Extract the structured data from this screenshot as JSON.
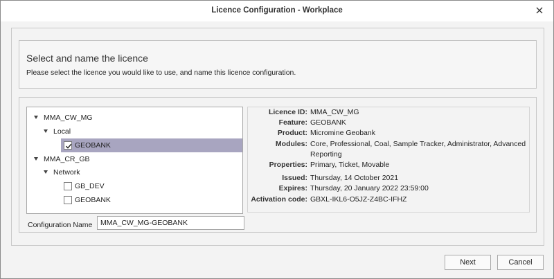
{
  "window": {
    "title": "Licence Configuration - Workplace",
    "close_icon": "close-icon"
  },
  "header": {
    "title": "Select and name the licence",
    "description": "Please select the licence you would like to use, and name this licence configuration."
  },
  "tree": {
    "nodes": [
      {
        "label": "MMA_CW_MG",
        "type": "expander",
        "expanded": true,
        "level": 0
      },
      {
        "label": "Local",
        "type": "expander",
        "expanded": true,
        "level": 1
      },
      {
        "label": "GEOBANK",
        "type": "checkbox",
        "checked": true,
        "selected": true,
        "level": 2
      },
      {
        "label": "MMA_CR_GB",
        "type": "expander",
        "expanded": true,
        "level": 0
      },
      {
        "label": "Network",
        "type": "expander",
        "expanded": true,
        "level": 1
      },
      {
        "label": "GB_DEV",
        "type": "checkbox",
        "checked": false,
        "selected": false,
        "level": 2
      },
      {
        "label": "GEOBANK",
        "type": "checkbox",
        "checked": false,
        "selected": false,
        "level": 2
      }
    ]
  },
  "details": {
    "licence_id": {
      "label": "Licence ID:",
      "value": "MMA_CW_MG"
    },
    "feature": {
      "label": "Feature:",
      "value": "GEOBANK"
    },
    "product": {
      "label": "Product:",
      "value": "Micromine Geobank"
    },
    "modules": {
      "label": "Modules:",
      "value": "Core, Professional, Coal, Sample Tracker, Administrator, Advanced Reporting"
    },
    "properties": {
      "label": "Properties:",
      "value": "Primary, Ticket, Movable"
    },
    "issued": {
      "label": "Issued:",
      "value": "Thursday, 14 October 2021"
    },
    "expires": {
      "label": "Expires:",
      "value": "Thursday, 20 January 2022 23:59:00"
    },
    "activation_code": {
      "label": "Activation code:",
      "value": "GBXL-IKL6-O5JZ-Z4BC-IFHZ"
    }
  },
  "config": {
    "label": "Configuration Name",
    "value": "MMA_CW_MG-GEOBANK"
  },
  "buttons": {
    "next": "Next",
    "cancel": "Cancel"
  },
  "colors": {
    "selection": "#a8a5c0",
    "dialog_background": "#f3f3f3"
  }
}
